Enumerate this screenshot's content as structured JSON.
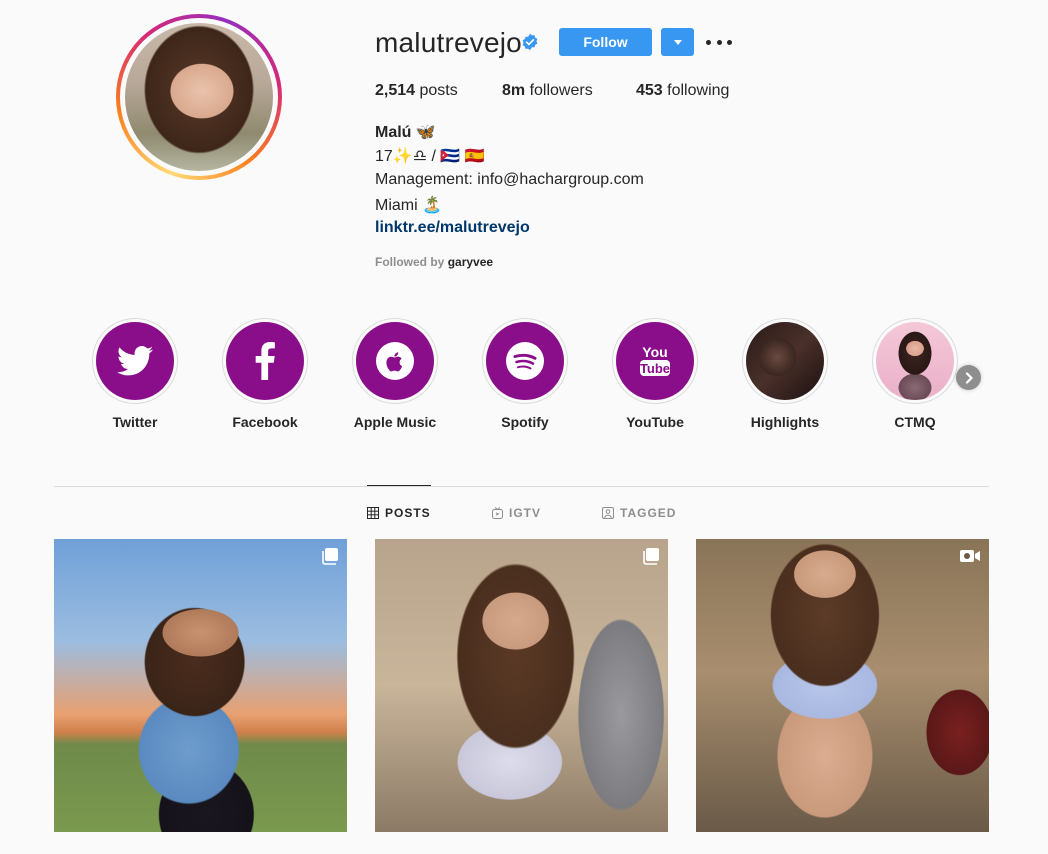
{
  "profile": {
    "username": "malutrevejo",
    "follow_label": "Follow",
    "stats": {
      "posts_count": "2,514",
      "posts_label": "posts",
      "followers_count": "8m",
      "followers_label": "followers",
      "following_count": "453",
      "following_label": "following"
    },
    "bio": {
      "name": "Malú 🦋",
      "line1": "17✨♎ / 🇨🇺 🇪🇸",
      "line2": "Management: info@hachargroup.com",
      "line3": "Miami 🏝️",
      "link": "linktr.ee/malutrevejo",
      "followed_by_label": "Followed by",
      "followed_by_user": "garyvee"
    }
  },
  "highlights": [
    {
      "label": "Twitter",
      "icon": "twitter-icon"
    },
    {
      "label": "Facebook",
      "icon": "facebook-icon"
    },
    {
      "label": "Apple Music",
      "icon": "apple-icon"
    },
    {
      "label": "Spotify",
      "icon": "spotify-icon"
    },
    {
      "label": "YouTube",
      "icon": "youtube-icon"
    },
    {
      "label": "Highlights",
      "icon": "photo"
    },
    {
      "label": "CTMQ",
      "icon": "photo"
    }
  ],
  "tabs": [
    {
      "label": "POSTS",
      "active": true
    },
    {
      "label": "IGTV",
      "active": false
    },
    {
      "label": "TAGGED",
      "active": false
    }
  ],
  "posts": [
    {
      "type": "carousel",
      "icon": "carousel-icon"
    },
    {
      "type": "carousel",
      "icon": "carousel-icon"
    },
    {
      "type": "video",
      "icon": "video-icon"
    }
  ],
  "colors": {
    "accent": "#3897f0",
    "highlight_bg": "#8a0e8a",
    "link": "#00376b",
    "muted": "#8e8e8e"
  }
}
